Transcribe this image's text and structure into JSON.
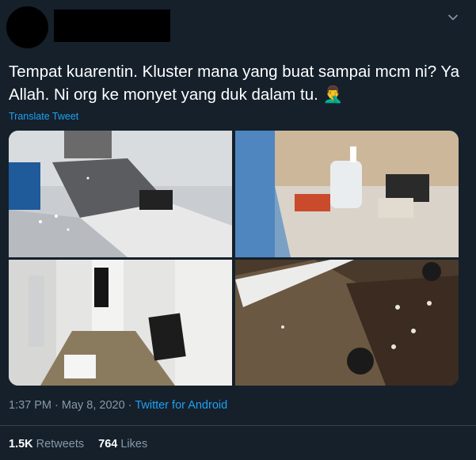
{
  "tweet": {
    "text": "Tempat kuarentin. Kluster mana yang buat sampai mcm ni? Ya Allah. Ni org ke monyet yang duk dalam tu. 🤦‍♂️",
    "translate_label": "Translate Tweet",
    "time": "1:37 PM · May 8, 2020 · ",
    "source": "Twitter for Android"
  },
  "stats": {
    "retweets_count": "1.5K",
    "retweets_label": "Retweets",
    "likes_count": "764",
    "likes_label": "Likes"
  },
  "icons": {
    "menu": "chevron-down-icon"
  },
  "colors": {
    "background": "#15202b",
    "link": "#1da1f2",
    "secondary_text": "#8899a6"
  }
}
